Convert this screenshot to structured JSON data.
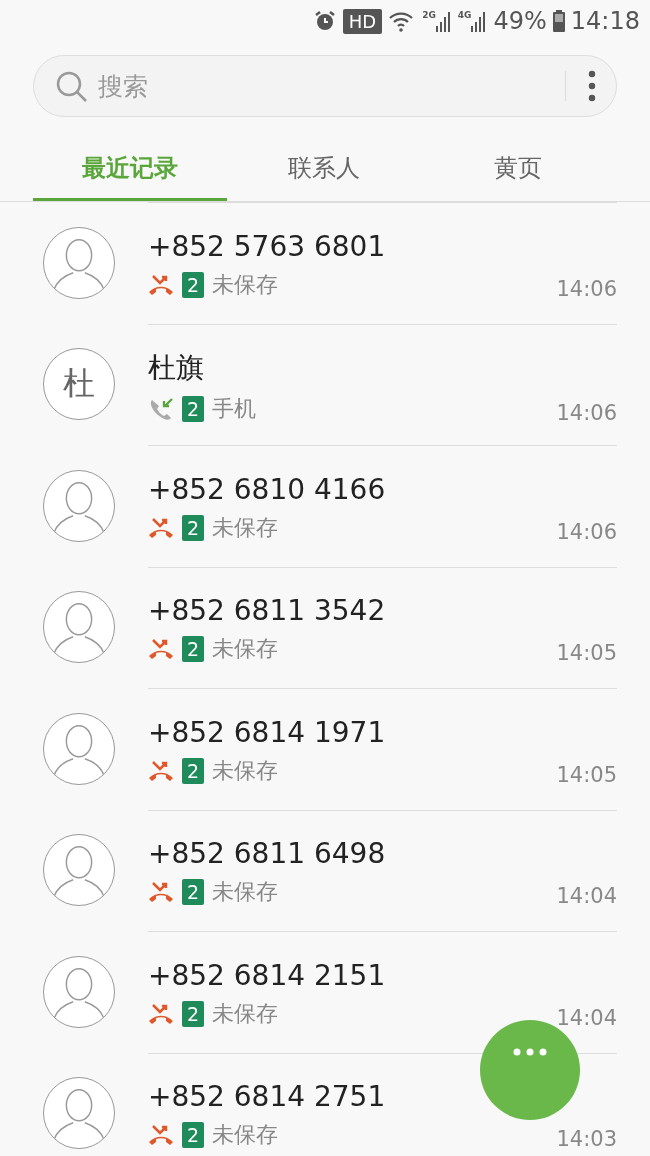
{
  "status_bar": {
    "hd": "HD",
    "net1": "2G",
    "net2": "4G",
    "battery": "49%",
    "time": "14:18"
  },
  "search": {
    "placeholder": "搜索"
  },
  "tabs": [
    {
      "label": "最近记录",
      "selected": true
    },
    {
      "label": "联系人",
      "selected": false
    },
    {
      "label": "黄页",
      "selected": false
    }
  ],
  "calls": [
    {
      "name": "+852 5763 6801",
      "kind": "missed",
      "sim": "2",
      "label": "未保存",
      "time": "14:06"
    },
    {
      "name": "杜旗",
      "avatar_letter": "杜",
      "kind": "received",
      "sim": "2",
      "label": "手机",
      "time": "14:06"
    },
    {
      "name": "+852 6810 4166",
      "kind": "missed",
      "sim": "2",
      "label": "未保存",
      "time": "14:06"
    },
    {
      "name": "+852 6811 3542",
      "kind": "missed",
      "sim": "2",
      "label": "未保存",
      "time": "14:05"
    },
    {
      "name": "+852 6814 1971",
      "kind": "missed",
      "sim": "2",
      "label": "未保存",
      "time": "14:05"
    },
    {
      "name": "+852 6811 6498",
      "kind": "missed",
      "sim": "2",
      "label": "未保存",
      "time": "14:04"
    },
    {
      "name": "+852 6814 2151",
      "kind": "missed",
      "sim": "2",
      "label": "未保存",
      "time": "14:04"
    },
    {
      "name": "+852 6814 2751",
      "kind": "missed",
      "sim": "2",
      "label": "未保存",
      "time": "14:03"
    }
  ]
}
